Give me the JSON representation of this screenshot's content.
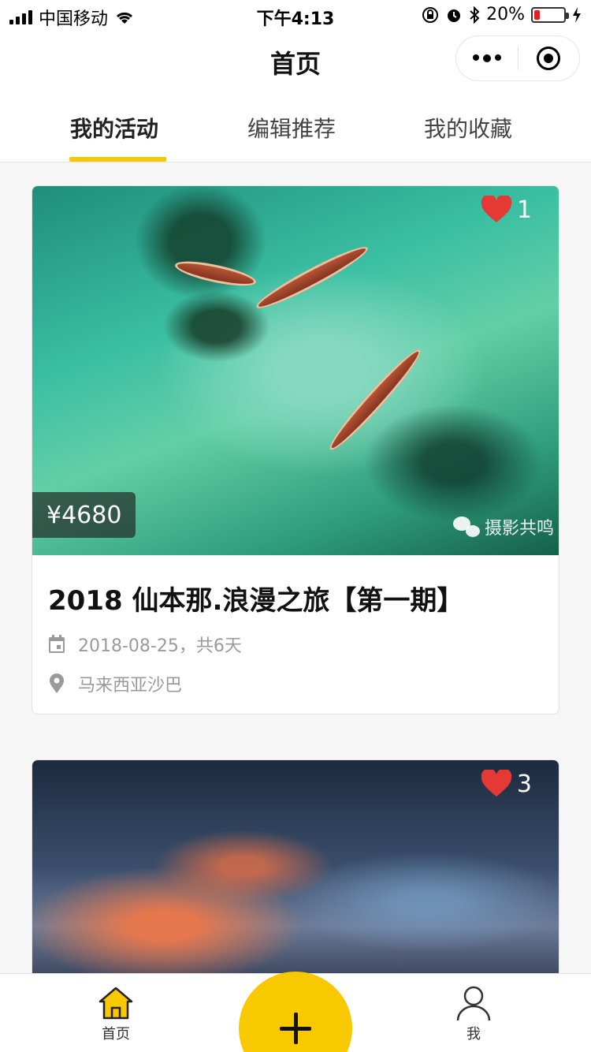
{
  "status": {
    "carrier": "中国移动",
    "time": "下午4:13",
    "battery_percent": "20%",
    "battery_level": 0.2
  },
  "nav": {
    "title": "首页"
  },
  "tabs": [
    {
      "label": "我的活动",
      "active": true
    },
    {
      "label": "编辑推荐",
      "active": false
    },
    {
      "label": "我的收藏",
      "active": false
    }
  ],
  "cards": [
    {
      "likes": "1",
      "price": "¥4680",
      "watermark": "摄影共鸣",
      "title": "2018 仙本那.浪漫之旅【第一期】",
      "date": "2018-08-25，共6天",
      "location": "马来西亚沙巴"
    },
    {
      "likes": "3"
    }
  ],
  "tabbar": {
    "home_label": "首页",
    "me_label": "我"
  },
  "colors": {
    "accent": "#f8c900",
    "like": "#e53935"
  }
}
